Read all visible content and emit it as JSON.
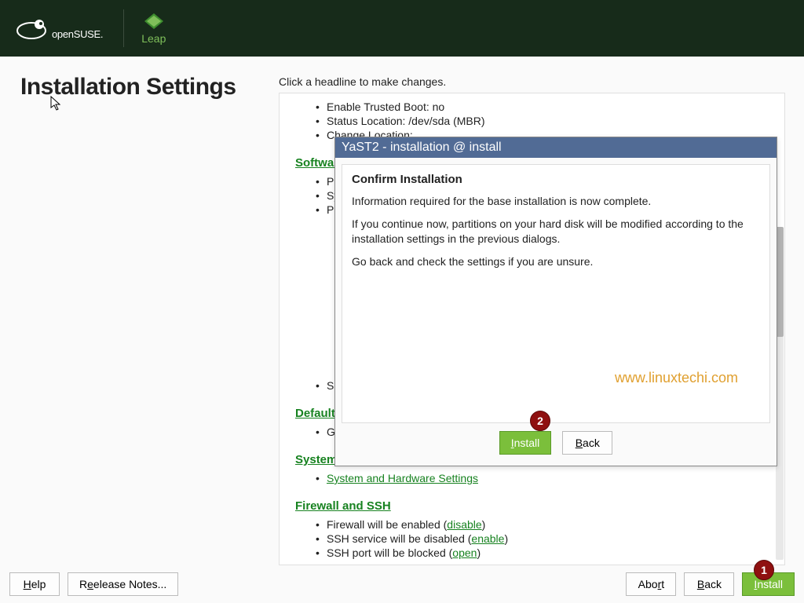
{
  "header": {
    "brand": "openSUSE.",
    "product": "Leap"
  },
  "page": {
    "title": "Installation Settings",
    "hint": "Click a headline to make changes."
  },
  "summary": {
    "boot": {
      "items": [
        "Enable Trusted Boot: no",
        "Status Location: /dev/sda (MBR)",
        "Change Location:"
      ]
    },
    "software": {
      "head": "Software",
      "items": [
        "Produ",
        "Syste",
        "Patte"
      ],
      "size_line": "Size "
    },
    "default_target": {
      "head": "Default sys",
      "items": [
        "Graph"
      ]
    },
    "system": {
      "head": "System",
      "link": "System and Hardware Settings"
    },
    "firewall": {
      "head": "Firewall and SSH",
      "fw_pre": "Firewall will be enabled (",
      "fw_link": "disable",
      "ssh_pre": "SSH service will be disabled (",
      "ssh_link": "enable",
      "port_pre": "SSH port will be blocked (",
      "port_link": "open"
    }
  },
  "dialog": {
    "title": "YaST2 - installation @ install",
    "heading": "Confirm Installation",
    "p1": "Information required for the base installation is now complete.",
    "p2": "If you continue now, partitions on your hard disk will be modified according to the installation settings in the previous dialogs.",
    "p3": "Go back and check the settings if you are unsure.",
    "watermark": "www.linuxtechi.com",
    "install_label": "nstall",
    "back_label": "ack"
  },
  "badges": {
    "one": "1",
    "two": "2"
  },
  "footer": {
    "help": "elp",
    "release_notes": "elease Notes...",
    "abort": "t",
    "abort_pre": "Abo",
    "back": "ack",
    "install": "nstall"
  }
}
